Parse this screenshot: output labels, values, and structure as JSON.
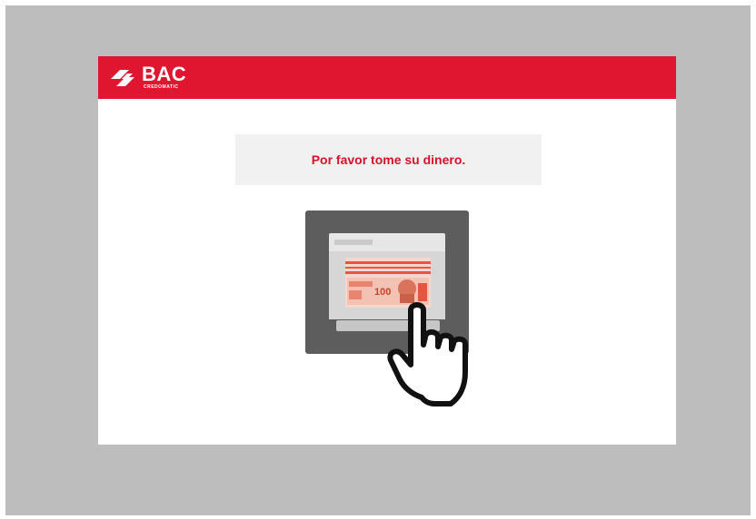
{
  "brand": {
    "name": "BAC",
    "sub": "CREDOMATIC"
  },
  "message": {
    "text": "Por favor tome su dinero."
  },
  "illustration": {
    "icon": "take-money-icon",
    "banknote_value": "100"
  },
  "colors": {
    "accent": "#e0152f",
    "message_text": "#d8102a",
    "bezel": "#bdbdbd",
    "dispenser": "#5d5d5d"
  }
}
